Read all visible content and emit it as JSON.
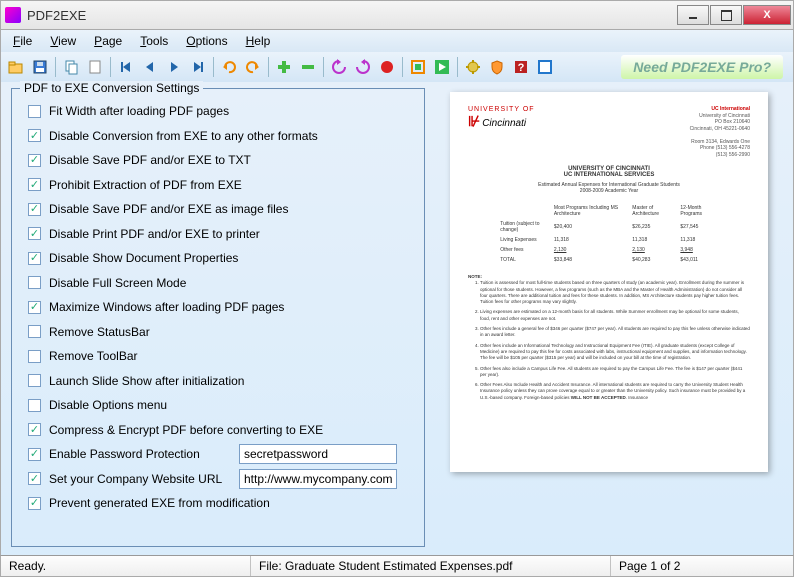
{
  "window": {
    "title": "PDF2EXE"
  },
  "menu": {
    "file": "File",
    "view": "View",
    "page": "Page",
    "tools": "Tools",
    "options": "Options",
    "help": "Help"
  },
  "promo": "Need PDF2EXE Pro?",
  "settings": {
    "legend": "PDF to EXE Conversion Settings",
    "items": [
      {
        "label": "Fit Width after loading PDF pages",
        "checked": false
      },
      {
        "label": "Disable Conversion from EXE to any other formats",
        "checked": true
      },
      {
        "label": "Disable Save PDF and/or EXE to TXT",
        "checked": true
      },
      {
        "label": "Prohibit Extraction of PDF from EXE",
        "checked": true
      },
      {
        "label": "Disable Save PDF and/or EXE as image files",
        "checked": true
      },
      {
        "label": "Disable Print PDF and/or EXE to printer",
        "checked": true
      },
      {
        "label": "Disable Show Document Properties",
        "checked": true
      },
      {
        "label": "Disable Full Screen Mode",
        "checked": false
      },
      {
        "label": "Maximize Windows after loading PDF pages",
        "checked": true
      },
      {
        "label": "Remove StatusBar",
        "checked": false
      },
      {
        "label": "Remove ToolBar",
        "checked": false
      },
      {
        "label": "Launch Slide Show after initialization",
        "checked": false
      },
      {
        "label": "Disable Options menu",
        "checked": false
      },
      {
        "label": "Compress & Encrypt PDF before converting to EXE",
        "checked": true
      },
      {
        "label": "Enable Password Protection",
        "checked": true,
        "input": "secretpassword"
      },
      {
        "label": "Set your Company Website URL",
        "checked": true,
        "input": "http://www.mycompany.com"
      },
      {
        "label": "Prevent generated EXE from modification",
        "checked": true
      }
    ]
  },
  "preview": {
    "brand_top": "UNIVERSITY OF",
    "brand": "Cincinnati",
    "addr_name": "UC International",
    "addr1": "University of Cincinnati",
    "addr2": "PO Box 210640",
    "addr3": "Cincinnati, OH 45221-0640",
    "addr4": "Room 3134, Edwards One",
    "addr5": "Phone (513) 556-4278",
    "addr6": "(513) 556-2990",
    "title1": "UNIVERSITY OF CINCINNATI",
    "title2": "UC INTERNATIONAL SERVICES",
    "subtitle": "Estimated Annual Expenses for International Graduate Students\n2008-2009 Academic Year",
    "col1": "Most Programs Including MS Architecture",
    "col2": "Master of Architecture",
    "col3": "12-Month Programs",
    "row1": "Tuition (subject to change)",
    "row2": "Living Expenses",
    "row3": "Other fees",
    "row4": "TOTAL",
    "notes_head": "NOTE:"
  },
  "status": {
    "ready": "Ready.",
    "file": "File: Graduate Student Estimated Expenses.pdf",
    "page": "Page 1 of 2"
  }
}
